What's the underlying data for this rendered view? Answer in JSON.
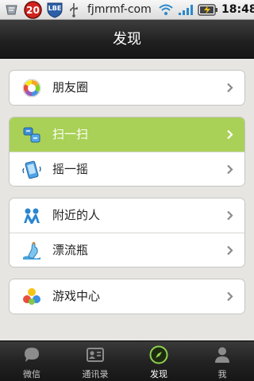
{
  "status_bar": {
    "badge_count": "20",
    "lbe_label": "LBE",
    "carrier": "fjmrmf-com",
    "time": "18:48",
    "icons": [
      "usb-icon",
      "wifi-icon",
      "signal-icon",
      "battery-charging-icon"
    ]
  },
  "header": {
    "title": "发现"
  },
  "menu": {
    "groups": [
      {
        "items": [
          {
            "label": "朋友圈",
            "icon": "moments-icon"
          }
        ]
      },
      {
        "items": [
          {
            "label": "扫一扫",
            "icon": "scan-icon",
            "selected": true
          },
          {
            "label": "摇一摇",
            "icon": "shake-icon"
          }
        ]
      },
      {
        "items": [
          {
            "label": "附近的人",
            "icon": "people-nearby-icon"
          },
          {
            "label": "漂流瓶",
            "icon": "drift-bottle-icon"
          }
        ]
      },
      {
        "items": [
          {
            "label": "游戏中心",
            "icon": "game-center-icon"
          }
        ]
      }
    ]
  },
  "tab_bar": {
    "tabs": [
      {
        "label": "微信",
        "icon": "chat-bubble-icon"
      },
      {
        "label": "通讯录",
        "icon": "contacts-icon"
      },
      {
        "label": "发现",
        "icon": "compass-icon",
        "active": true
      },
      {
        "label": "我",
        "icon": "person-icon"
      }
    ]
  },
  "colors": {
    "selected_row": "#a9d157",
    "title_bar": "#1f1f1f",
    "background": "#e6e5e1",
    "tab_active": "#8fd14f"
  }
}
